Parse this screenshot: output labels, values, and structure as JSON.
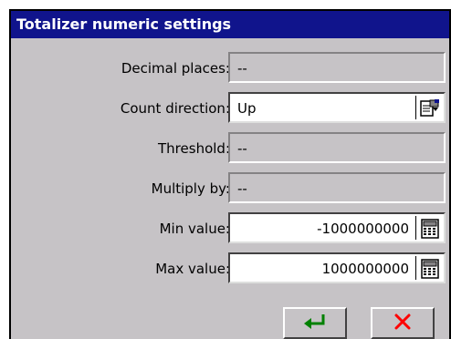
{
  "window": {
    "title": "Totalizer numeric settings"
  },
  "fields": [
    {
      "label": "Decimal places:",
      "value": "--"
    },
    {
      "label": "Count direction:",
      "value": "Up"
    },
    {
      "label": "Threshold:",
      "value": "--"
    },
    {
      "label": "Multiply by:",
      "value": "--"
    },
    {
      "label": "Min value:",
      "value": "-1000000000"
    },
    {
      "label": "Max value:",
      "value": "1000000000"
    }
  ],
  "icons": {
    "count_direction": "dropdown-properties-icon",
    "min_value": "calculator-icon",
    "max_value": "calculator-icon",
    "ok": "enter-arrow-icon",
    "cancel": "cross-icon"
  },
  "colors": {
    "title_bar": "#10148c",
    "title_text": "#ffffff",
    "dialog_bg": "#c6c3c6",
    "ok_icon": "#008000",
    "cancel_icon": "#ff0000"
  }
}
